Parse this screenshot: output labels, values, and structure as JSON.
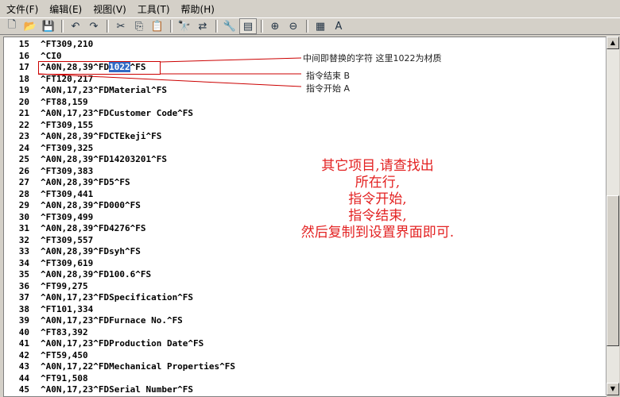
{
  "menu": [
    "文件(F)",
    "编辑(E)",
    "视图(V)",
    "工具(T)",
    "帮助(H)"
  ],
  "toolbar_icons": [
    "new-file-icon",
    "open-folder-icon",
    "save-icon",
    "undo-icon",
    "redo-icon",
    "cut-icon",
    "copy-icon",
    "paste-icon",
    "find-icon",
    "replace-icon",
    "wrench-icon",
    "view-icon",
    "zoom-in-icon",
    "zoom-out-icon",
    "settings-icon",
    "font-icon"
  ],
  "lines": [
    {
      "n": "15",
      "t": "^FT309,210"
    },
    {
      "n": "16",
      "t": "^CI0"
    },
    {
      "n": "17",
      "t": "^A0N,28,39^FD",
      "sel": "1022",
      "rest": "^FS"
    },
    {
      "n": "18",
      "t": "^FT120,217"
    },
    {
      "n": "19",
      "t": "^A0N,17,23^FDMaterial^FS"
    },
    {
      "n": "20",
      "t": "^FT88,159"
    },
    {
      "n": "21",
      "t": "^A0N,17,23^FDCustomer Code^FS"
    },
    {
      "n": "22",
      "t": "^FT309,155"
    },
    {
      "n": "23",
      "t": "^A0N,28,39^FDCTEkeji^FS"
    },
    {
      "n": "24",
      "t": "^FT309,325"
    },
    {
      "n": "25",
      "t": "^A0N,28,39^FD14203201^FS"
    },
    {
      "n": "26",
      "t": "^FT309,383"
    },
    {
      "n": "27",
      "t": "^A0N,28,39^FD5^FS"
    },
    {
      "n": "28",
      "t": "^FT309,441"
    },
    {
      "n": "29",
      "t": "^A0N,28,39^FD000^FS"
    },
    {
      "n": "30",
      "t": "^FT309,499"
    },
    {
      "n": "31",
      "t": "^A0N,28,39^FD4276^FS"
    },
    {
      "n": "32",
      "t": "^FT309,557"
    },
    {
      "n": "33",
      "t": "^A0N,28,39^FDsyh^FS"
    },
    {
      "n": "34",
      "t": "^FT309,619"
    },
    {
      "n": "35",
      "t": "^A0N,28,39^FD100.6^FS"
    },
    {
      "n": "36",
      "t": "^FT99,275"
    },
    {
      "n": "37",
      "t": "^A0N,17,23^FDSpecification^FS"
    },
    {
      "n": "38",
      "t": "^FT101,334"
    },
    {
      "n": "39",
      "t": "^A0N,17,23^FDFurnace No.^FS"
    },
    {
      "n": "40",
      "t": "^FT83,392"
    },
    {
      "n": "41",
      "t": "^A0N,17,23^FDProduction Date^FS"
    },
    {
      "n": "42",
      "t": "^FT59,450"
    },
    {
      "n": "43",
      "t": "^A0N,17,22^FDMechanical Properties^FS"
    },
    {
      "n": "44",
      "t": "^FT91,508"
    },
    {
      "n": "45",
      "t": "^A0N,17,23^FDSerial Number^FS"
    }
  ],
  "annotations": {
    "replace": "中间即替换的字符 这里1022为材质",
    "end": "指令结束 B",
    "start": "指令开始 A"
  },
  "instructions": [
    "其它项目,请查找出",
    "所在行,",
    "指令开始,",
    "指令结束,",
    "然后复制到设置界面即可."
  ],
  "colors": {
    "annotation_red": "#cc0000",
    "selection": "#316ac5",
    "instruction_text": "#e32222"
  }
}
